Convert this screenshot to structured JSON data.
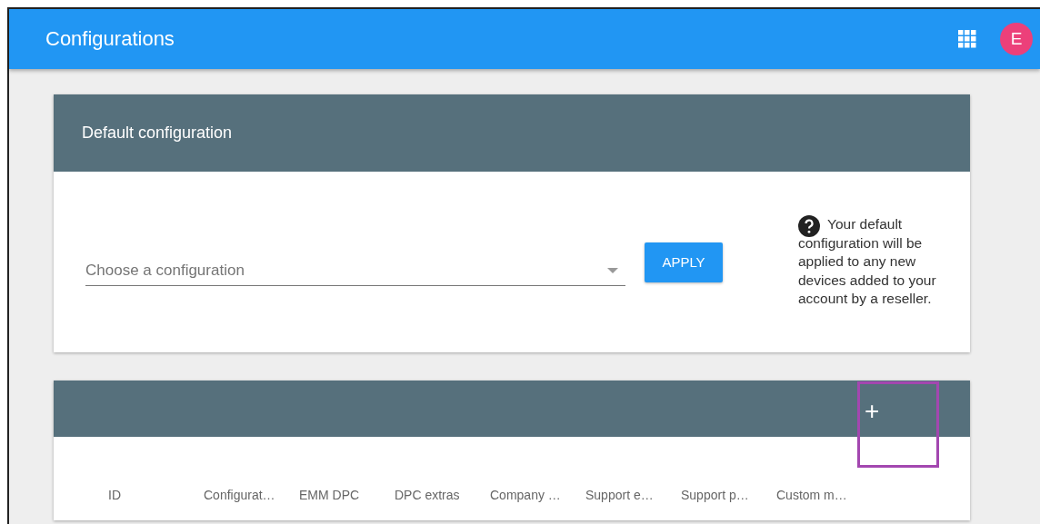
{
  "app_bar": {
    "title": "Configurations",
    "avatar_letter": "E"
  },
  "default_card": {
    "title": "Default configuration",
    "select": {
      "placeholder": "Choose a configuration"
    },
    "apply_button": "APPLY",
    "help_text": "Your default configuration will be applied to any new devices added to your account by a reseller."
  },
  "table_card": {
    "add_button": "+",
    "add_highlighted": true,
    "columns": [
      "ID",
      "Configurat…",
      "EMM DPC",
      "DPC extras",
      "Company …",
      "Support e…",
      "Support p…",
      "Custom m…"
    ]
  }
}
